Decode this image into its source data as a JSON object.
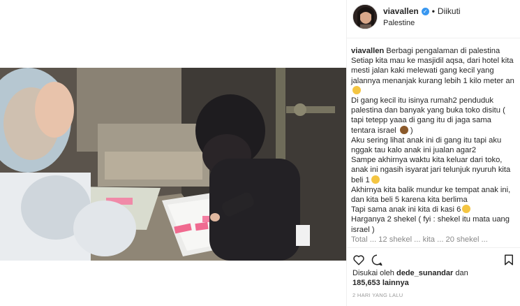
{
  "header": {
    "username": "viavallen",
    "follow_status": "Diikuti",
    "location": "Palestine"
  },
  "caption": {
    "username": "viavallen",
    "lines": [
      "Berbagi pengalaman di palestina",
      "Setiap kita mau ke masjidil aqsa, dari hotel kita mesti jalan kaki melewati gang kecil yang jalannya menanjak kurang lebih 1 kilo meter an",
      "Di gang kecil itu isinya rumah2 penduduk palestina dan banyak yang buka toko disitu ( tapi tetepp yaaa di gang itu di jaga sama tentara israel",
      ")",
      "Aku sering lihat anak ini di gang itu tapi aku nggak tau kalo anak ini jualan agar2",
      "Sampe akhirnya waktu kita keluar dari toko, anak ini ngasih isyarat jari telunjuk nyuruh kita beli 1",
      "Akhirnya kita balik mundur ke tempat anak ini, dan kita beli 5 karena kita berlima",
      "Tapi sama anak ini kita di kasi 6",
      "Harganya 2 shekel ( fyi : shekel itu mata uang israel )",
      "Total ... 12 shekel ... kita ... 20 shekel ..."
    ]
  },
  "likes": {
    "prefix": "Disukai oleh",
    "user": "dede_sunandar",
    "joiner": "dan",
    "count": "185,653",
    "suffix": "lainnya"
  },
  "timestamp": "2 HARI YANG LALU",
  "icons": {
    "like": "heart-icon",
    "comment": "comment-icon",
    "save": "bookmark-icon",
    "verified": "verified-badge-icon"
  },
  "colors": {
    "verified": "#3897f0",
    "text": "#262626",
    "muted": "#999999",
    "border": "#efefef"
  }
}
